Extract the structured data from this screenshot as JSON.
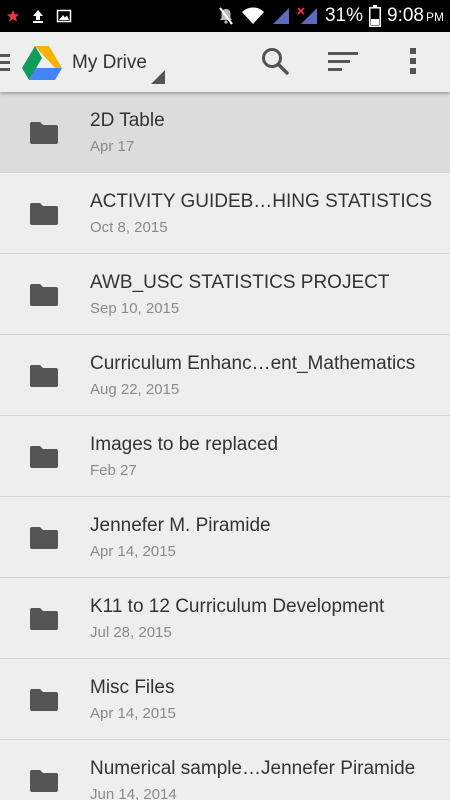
{
  "status_bar": {
    "battery_percent": "31%",
    "time": "9:08",
    "ampm": "PM",
    "left_icons": [
      "star-icon",
      "upload-icon",
      "image-icon"
    ],
    "right_icons": [
      "mute-icon",
      "wifi-icon",
      "signal-icon",
      "signal-x-icon",
      "battery-icon"
    ]
  },
  "app_bar": {
    "title": "My Drive",
    "icons": [
      "menu-icon",
      "drive-logo-icon",
      "search-icon",
      "sort-icon",
      "more-vert-icon"
    ]
  },
  "files": [
    {
      "name": "2D Table",
      "date": "Apr 17",
      "selected": true
    },
    {
      "name": "ACTIVITY GUIDEB…HING STATISTICS",
      "date": "Oct 8, 2015"
    },
    {
      "name": "AWB_USC STATISTICS PROJECT",
      "date": "Sep 10, 2015"
    },
    {
      "name": "Curriculum Enhanc…ent_Mathematics",
      "date": "Aug 22, 2015"
    },
    {
      "name": "Images to be replaced",
      "date": "Feb 27"
    },
    {
      "name": "Jennefer M. Piramide",
      "date": "Apr 14, 2015"
    },
    {
      "name": "K11 to 12 Curriculum Development",
      "date": "Jul 28, 2015"
    },
    {
      "name": "Misc Files",
      "date": "Apr 14, 2015"
    },
    {
      "name": "Numerical sample…Jennefer Piramide",
      "date": "Jun 14, 2014"
    }
  ],
  "colors": {
    "status_bar_bg": "#000000",
    "app_bg": "#eeeeee",
    "selected_row_bg": "#dcdcdc",
    "folder_icon": "#555555",
    "drive_green": "#0f9d58",
    "drive_yellow": "#f4b400",
    "drive_blue": "#4285f4"
  }
}
